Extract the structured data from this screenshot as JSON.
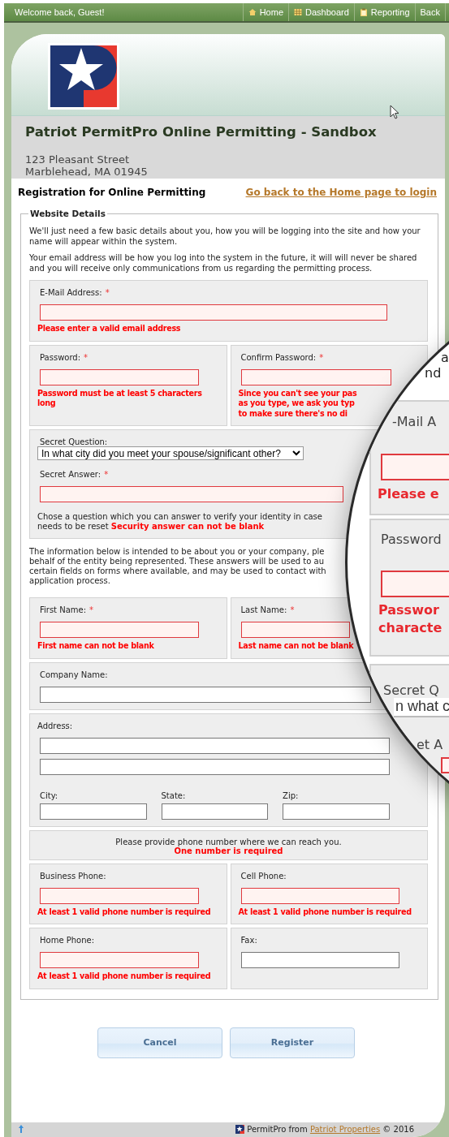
{
  "top_bar": {
    "welcome": "Welcome back, Guest!",
    "nav": [
      "Home",
      "Dashboard",
      "Reporting",
      "Back"
    ]
  },
  "header": {
    "title": "Patriot PermitPro Online Permitting - Sandbox",
    "address_lines": [
      "123 Pleasant Street",
      "Marblehead, MA 01945"
    ]
  },
  "page_heading": "Registration for Online Permitting",
  "home_link": "Go back to the Home page to login",
  "section": {
    "legend": "Website Details",
    "blocks": [
      {
        "kind": "paragraph",
        "text": "We'll just need a few basic details about you, how you will be logging into the site and how your name will appear within the system."
      },
      {
        "kind": "paragraph",
        "text": "Your email address will be how you log into the system in the future, it will will never be shared and you will receive only communications from us regarding the permitting process."
      },
      {
        "kind": "row",
        "cells": [
          {
            "label": "E-Mail Address:",
            "mark": "*",
            "invalid": true,
            "error": "Please enter a valid email address"
          }
        ]
      },
      {
        "kind": "row",
        "cells": [
          {
            "label": "Password:",
            "mark": "*",
            "invalid": true,
            "error": "Password must be at least 5 characters long"
          },
          {
            "label": "Confirm Password:",
            "mark": "*",
            "invalid": true,
            "error_lines": [
              "Since you can't see your pas",
              "as you type, we ask you typ",
              "to make sure there's no di"
            ]
          }
        ]
      },
      {
        "kind": "secret",
        "label": "Secret Question:",
        "question": "In what city did you meet your spouse/significant other?",
        "answer_label": "Secret Answer:",
        "mark": "*",
        "invalid": true,
        "note_lines": [
          "Chose a question which you can answer to verify your identity in case",
          "needs to be reset"
        ],
        "error": "Security answer can not be blank"
      },
      {
        "kind": "paragraph",
        "lines": [
          "The information below is intended to be about you or your company, ple",
          "behalf of the entity being represented. These answers will be used to au",
          "certain fields on forms where available, and may be used to contact with",
          "application process."
        ]
      },
      {
        "kind": "row",
        "cells": [
          {
            "label": "First Name:",
            "mark": "*",
            "invalid": true,
            "error": "First name can not be blank"
          },
          {
            "label": "Last Name:",
            "mark": "*",
            "invalid": true,
            "error": "Last name can not be blank"
          }
        ]
      },
      {
        "kind": "row",
        "cells": [
          {
            "label": "Company Name:",
            "invalid": false
          }
        ]
      },
      {
        "kind": "address",
        "label": "Address:",
        "lines": [
          {
            "invalid": false
          },
          {
            "invalid": false
          }
        ],
        "parts": [
          {
            "label": "City:",
            "invalid": false
          },
          {
            "label": "State:",
            "invalid": false
          },
          {
            "label": "Zip:",
            "invalid": false
          }
        ]
      },
      {
        "kind": "note",
        "text": "Please provide phone number where we can reach you.",
        "error": "One number is required"
      },
      {
        "kind": "row",
        "cells": [
          {
            "label": "Business Phone:",
            "invalid": true,
            "error": "At least 1 valid phone number is required"
          },
          {
            "label": "Cell Phone:",
            "invalid": true,
            "error": "At least 1 valid phone number is required"
          }
        ]
      },
      {
        "kind": "row",
        "cells": [
          {
            "label": "Home Phone:",
            "invalid": true,
            "error": "At least 1 valid phone number is required"
          },
          {
            "label": "Fax:",
            "invalid": false
          }
        ]
      }
    ]
  },
  "buttons": [
    "Cancel",
    "Register"
  ],
  "footer": {
    "prefix": "PermitPro from",
    "link": "Patriot Properties",
    "suffix": "© 2016"
  },
  "magnifier": {
    "fragments": [
      {
        "kind": "plain",
        "text": "a"
      },
      {
        "kind": "plain",
        "text": "nd"
      },
      {
        "kind": "label",
        "text": "-Mail A"
      },
      {
        "kind": "error",
        "text": "Please e"
      },
      {
        "kind": "label",
        "text": "Password"
      },
      {
        "kind": "error",
        "text": "Passwor"
      },
      {
        "kind": "error",
        "text": "characte"
      },
      {
        "kind": "label",
        "text": "Secret Q"
      },
      {
        "kind": "select",
        "text": "n what c"
      },
      {
        "kind": "label",
        "text": "et A"
      }
    ]
  }
}
